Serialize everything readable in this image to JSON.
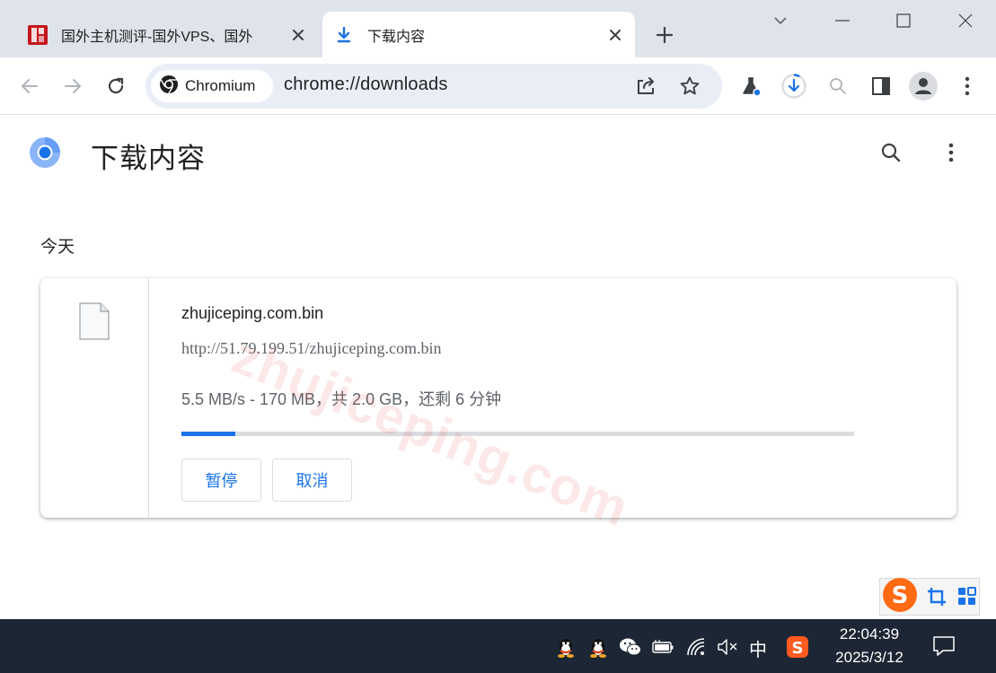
{
  "tabs": [
    {
      "title": "国外主机测评-国外VPS、国外",
      "active": false
    },
    {
      "title": "下载内容",
      "active": true
    }
  ],
  "toolbar": {
    "site_chip_label": "Chromium",
    "url": "chrome://downloads"
  },
  "page": {
    "title": "下载内容",
    "date_group": "今天"
  },
  "download": {
    "file_name": "zhujiceping.com.bin",
    "source_url": "http://51.79.199.51/zhujiceping.com.bin",
    "status": "5.5 MB/s - 170 MB，共 2.0 GB，还剩 6 分钟",
    "progress_fraction": 0.08,
    "pause_label": "暂停",
    "cancel_label": "取消"
  },
  "watermark": "zhujiceping.com",
  "taskbar": {
    "ime_label": "中",
    "time": "22:04:39",
    "date": "2025/3/12"
  },
  "colors": {
    "accent": "#1a73e8",
    "tabstrip": "#dfe3ea",
    "omnibox": "#e9eef6",
    "taskbar": "#1c2634"
  }
}
